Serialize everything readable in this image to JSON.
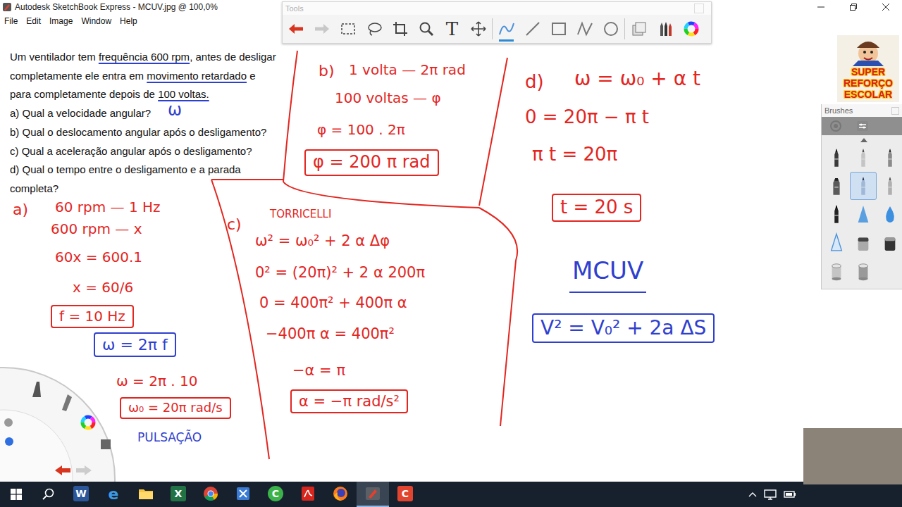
{
  "window": {
    "title": "Autodesk SketchBook Express - MCUV.jpg @ 100,0%"
  },
  "menu": [
    "File",
    "Edit",
    "Image",
    "Window",
    "Help"
  ],
  "tools_palette": {
    "title": "Tools",
    "tools": [
      {
        "kind": "undo",
        "selected": false
      },
      {
        "kind": "redo",
        "selected": false
      },
      {
        "kind": "select",
        "selected": false
      },
      {
        "kind": "lasso",
        "selected": false
      },
      {
        "kind": "crop",
        "selected": false
      },
      {
        "kind": "zoom",
        "selected": false
      },
      {
        "kind": "text",
        "label": "T",
        "selected": false
      },
      {
        "kind": "move",
        "selected": false
      },
      {
        "kind": "pen",
        "selected": true
      },
      {
        "kind": "line",
        "selected": false
      },
      {
        "kind": "rect",
        "selected": false
      },
      {
        "kind": "zigzag",
        "selected": false
      },
      {
        "kind": "ellipse",
        "selected": false
      },
      {
        "kind": "layers",
        "selected": false
      },
      {
        "kind": "brushes",
        "selected": false
      },
      {
        "kind": "colors",
        "selected": false
      }
    ]
  },
  "problem": [
    {
      "segments": [
        {
          "text": "Um ventilador tem ",
          "underlined": false
        },
        {
          "text": "frequência 600 rpm",
          "underlined": true
        },
        {
          "text": ", antes de desligar",
          "underlined": false
        }
      ]
    },
    {
      "segments": [
        {
          "text": "completamente ele entra em ",
          "underlined": false
        },
        {
          "text": "movimento retardado",
          "underlined": true
        },
        {
          "text": " e",
          "underlined": false
        }
      ]
    },
    {
      "segments": [
        {
          "text": "para completamente depois de ",
          "underlined": false
        },
        {
          "text": "100 voltas.",
          "underlined": true
        }
      ]
    },
    {
      "segments": [
        {
          "text": "a) Qual a velocidade angular?",
          "underlined": false
        }
      ]
    },
    {
      "segments": [
        {
          "text": "b) Qual o deslocamento angular após o desligamento?",
          "underlined": false
        }
      ]
    },
    {
      "segments": [
        {
          "text": "c) Qual a aceleração angular após o desligamento?",
          "underlined": false
        }
      ]
    },
    {
      "segments": [
        {
          "text": "d) Qual o tempo entre o desligamento e a parada",
          "underlined": false
        }
      ]
    },
    {
      "segments": [
        {
          "text": "completa?",
          "underlined": false
        }
      ]
    }
  ],
  "notes": [
    {
      "text": "ω",
      "color": "#2f3fcf",
      "boxed": false,
      "underlined": false
    },
    {
      "text": "a)",
      "color": "#e3261f",
      "boxed": false,
      "underlined": false
    },
    {
      "text": "60 rpm — 1 Hz",
      "color": "#e3261f",
      "boxed": false,
      "underlined": false
    },
    {
      "text": "600 rpm — x",
      "color": "#e3261f",
      "boxed": false,
      "underlined": false
    },
    {
      "text": "60x = 600.1",
      "color": "#e3261f",
      "boxed": false,
      "underlined": false
    },
    {
      "text": "x = 60/6",
      "color": "#e3261f",
      "boxed": false,
      "underlined": false
    },
    {
      "text": "f = 10 Hz",
      "color": "#e3261f",
      "boxed": true,
      "underlined": false
    },
    {
      "text": "ω = 2π f",
      "color": "#2f3fcf",
      "boxed": true,
      "underlined": false
    },
    {
      "text": "ω = 2π . 10",
      "color": "#e3261f",
      "boxed": false,
      "underlined": false
    },
    {
      "text": "ω₀ = 20π rad/s",
      "color": "#e3261f",
      "boxed": true,
      "underlined": false
    },
    {
      "text": "PULSAÇÃO",
      "color": "#2f3fcf",
      "boxed": false,
      "underlined": false
    },
    {
      "text": "b)",
      "color": "#e3261f",
      "boxed": false,
      "underlined": false
    },
    {
      "text": "1 volta — 2π rad",
      "color": "#e3261f",
      "boxed": false,
      "underlined": false
    },
    {
      "text": "100 voltas — φ",
      "color": "#e3261f",
      "boxed": false,
      "underlined": false
    },
    {
      "text": "φ = 100 . 2π",
      "color": "#e3261f",
      "boxed": false,
      "underlined": false
    },
    {
      "text": "φ = 200 π rad",
      "color": "#e3261f",
      "boxed": true,
      "underlined": false
    },
    {
      "text": "c)",
      "color": "#e3261f",
      "boxed": false,
      "underlined": false
    },
    {
      "text": "TORRICELLI",
      "color": "#e3261f",
      "boxed": false,
      "underlined": false
    },
    {
      "text": "ω² = ω₀² + 2 α Δφ",
      "color": "#e3261f",
      "boxed": false,
      "underlined": false
    },
    {
      "text": "0² = (20π)² + 2 α 200π",
      "color": "#e3261f",
      "boxed": false,
      "underlined": false
    },
    {
      "text": "0 = 400π² + 400π α",
      "color": "#e3261f",
      "boxed": false,
      "underlined": false
    },
    {
      "text": "−400π α = 400π²",
      "color": "#e3261f",
      "boxed": false,
      "underlined": false
    },
    {
      "text": "−α = π",
      "color": "#e3261f",
      "boxed": false,
      "underlined": false
    },
    {
      "text": "α = −π rad/s²",
      "color": "#e3261f",
      "boxed": true,
      "underlined": false
    },
    {
      "text": "d)",
      "color": "#e3261f",
      "boxed": false,
      "underlined": false
    },
    {
      "text": "ω = ω₀ + α t",
      "color": "#e3261f",
      "boxed": false,
      "underlined": false
    },
    {
      "text": "0 = 20π − π t",
      "color": "#e3261f",
      "boxed": false,
      "underlined": false
    },
    {
      "text": "π t = 20π",
      "color": "#e3261f",
      "boxed": false,
      "underlined": false
    },
    {
      "text": "t = 20 s",
      "color": "#e3261f",
      "boxed": true,
      "underlined": false
    },
    {
      "text": "MCUV",
      "color": "#2f3fcf",
      "boxed": false,
      "underlined": true
    },
    {
      "text": "V² = V₀² + 2a ΔS",
      "color": "#2f3fcf",
      "boxed": true,
      "underlined": false
    }
  ],
  "brushes": {
    "title": "Brushes",
    "items": [
      {
        "kind": "pencil",
        "selected": false
      },
      {
        "kind": "fineliner",
        "selected": false
      },
      {
        "kind": "pen",
        "selected": false
      },
      {
        "kind": "marker",
        "selected": false
      },
      {
        "kind": "ballpoint",
        "selected": true
      },
      {
        "kind": "chisel",
        "selected": false
      },
      {
        "kind": "inkpen",
        "selected": false
      },
      {
        "kind": "airbrush",
        "selected": false
      },
      {
        "kind": "drop",
        "selected": false
      },
      {
        "kind": "triangle",
        "selected": false
      },
      {
        "kind": "block",
        "selected": false
      },
      {
        "kind": "eraser",
        "selected": false
      },
      {
        "kind": "bucket",
        "selected": false
      },
      {
        "kind": "bucket2",
        "selected": false
      }
    ]
  },
  "logo": {
    "lines": [
      "SUPER",
      "REFORÇO",
      "ESCOLAR"
    ]
  },
  "taskbar": {
    "apps": [
      {
        "kind": "word",
        "label": "W",
        "active": false
      },
      {
        "kind": "edge",
        "label": "e",
        "active": false
      },
      {
        "kind": "explorer",
        "active": false
      },
      {
        "kind": "excel",
        "label": "X",
        "active": false
      },
      {
        "kind": "chrome",
        "active": false
      },
      {
        "kind": "app",
        "active": false
      },
      {
        "kind": "camtasia-green",
        "label": "C",
        "active": false
      },
      {
        "kind": "pdf",
        "active": false
      },
      {
        "kind": "firefox",
        "active": false
      },
      {
        "kind": "sketchbook",
        "active": true
      },
      {
        "kind": "camtasia-red",
        "label": "C",
        "active": false
      }
    ]
  }
}
